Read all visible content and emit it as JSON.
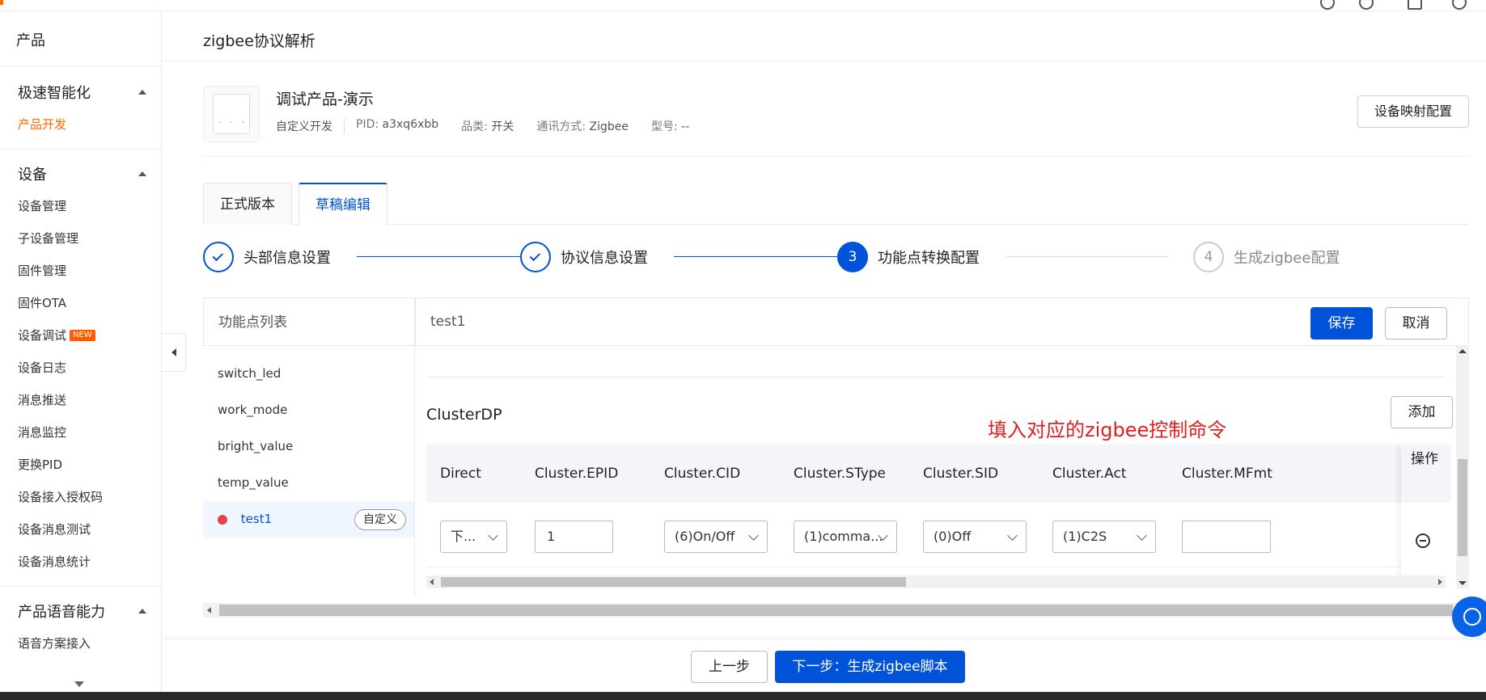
{
  "sidebar": {
    "top_label": "产品",
    "groups": [
      {
        "title": "极速智能化",
        "items": [
          {
            "label": "产品开发",
            "active": true
          }
        ]
      },
      {
        "title": "设备",
        "items": [
          {
            "label": "设备管理"
          },
          {
            "label": "子设备管理"
          },
          {
            "label": "固件管理"
          },
          {
            "label": "固件OTA"
          },
          {
            "label": "设备调试",
            "badge": "NEW"
          },
          {
            "label": "设备日志"
          },
          {
            "label": "消息推送"
          },
          {
            "label": "消息监控"
          },
          {
            "label": "更换PID"
          },
          {
            "label": "设备接入授权码"
          },
          {
            "label": "设备消息测试"
          },
          {
            "label": "设备消息统计"
          }
        ]
      },
      {
        "title": "产品语音能力",
        "items": [
          {
            "label": "语音方案接入"
          }
        ]
      }
    ]
  },
  "page": {
    "title": "zigbee协议解析"
  },
  "product": {
    "name": "调试产品-演示",
    "dev_type": "自定义开发",
    "pid_label": "PID:",
    "pid": "a3xq6xbb",
    "category_label": "品类:",
    "category": "开关",
    "comm_label": "通讯方式:",
    "comm": "Zigbee",
    "model_label": "型号:",
    "model": "--",
    "map_button": "设备映射配置",
    "thumb_marks": [
      "-",
      "-",
      "-"
    ]
  },
  "tabs": [
    {
      "label": "正式版本",
      "active": false
    },
    {
      "label": "草稿编辑",
      "active": true
    }
  ],
  "steps": [
    {
      "label": "头部信息设置",
      "state": "done"
    },
    {
      "label": "协议信息设置",
      "state": "done"
    },
    {
      "label": "功能点转换配置",
      "state": "current",
      "num": "3"
    },
    {
      "label": "生成zigbee配置",
      "state": "todo",
      "num": "4"
    }
  ],
  "fp_list": {
    "header": "功能点列表",
    "items": [
      {
        "label": "switch_led"
      },
      {
        "label": "work_mode"
      },
      {
        "label": "bright_value"
      },
      {
        "label": "temp_value"
      },
      {
        "label": "test1",
        "active": true,
        "tag": "自定义"
      }
    ]
  },
  "detail": {
    "current_dp": "test1",
    "save": "保存",
    "cancel": "取消",
    "cluster_title": "ClusterDP",
    "add": "添加",
    "annotation": "填入对应的zigbee控制命令",
    "columns": [
      "Direct",
      "Cluster.EPID",
      "Cluster.CID",
      "Cluster.SType",
      "Cluster.SID",
      "Cluster.Act",
      "Cluster.MFmt"
    ],
    "op_header": "操作",
    "row": {
      "direct": "下...",
      "epid": "1",
      "cid": "(6)On/Off",
      "stype": "(1)comma...",
      "sid": "(0)Off",
      "act": "(1)C2S",
      "mfmt": ""
    }
  },
  "footer": {
    "prev": "上一步",
    "next": "下一步：生成zigbee脚本"
  },
  "colors": {
    "primary": "#0052d9",
    "accent": "#ff6a00",
    "annotation": "#e02020",
    "danger_dot": "#e54545"
  }
}
